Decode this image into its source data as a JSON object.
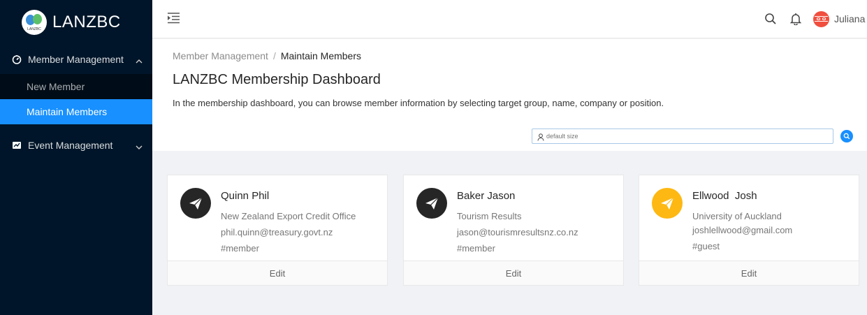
{
  "app": {
    "logo_text": "LANZBC",
    "logo_small": "LANZBC"
  },
  "sidebar": {
    "member_menu": {
      "label": "Member Management",
      "icon": "dashboard-icon"
    },
    "member_items": [
      {
        "label": "New Member"
      },
      {
        "label": "Maintain Members"
      }
    ],
    "event_menu": {
      "label": "Event Management",
      "icon": "form-icon"
    }
  },
  "header": {
    "username": "Juliana"
  },
  "breadcrumb": {
    "parent": "Member Management",
    "separator": "/",
    "current": "Maintain Members"
  },
  "page": {
    "title": "LANZBC Membership Dashboard",
    "description": "In the membership dashboard, you can browse member information by selecting target group, name, company or position."
  },
  "search": {
    "placeholder": "default size",
    "value": ""
  },
  "cards": [
    {
      "name": "Quinn Phil",
      "organization": "New Zealand Export Credit Office",
      "email": "phil.quinn@treasury.govt.nz",
      "tag": "#member",
      "edit_label": "Edit",
      "avatar_color": "#262626"
    },
    {
      "name": "Baker Jason",
      "organization": "Tourism Results",
      "email": "jason@tourismresultsnz.co.nz",
      "tag": "#member",
      "edit_label": "Edit",
      "avatar_color": "#262626"
    },
    {
      "name": "Ellwood  Josh",
      "organization": "University of Auckland",
      "email": "joshlellwood@gmail.com",
      "tag": "#guest",
      "edit_label": "Edit",
      "avatar_color": "#fdb813"
    }
  ],
  "colors": {
    "sidebar_bg": "#001529",
    "accent": "#1890ff",
    "avatar_red": "#f04e3e"
  }
}
